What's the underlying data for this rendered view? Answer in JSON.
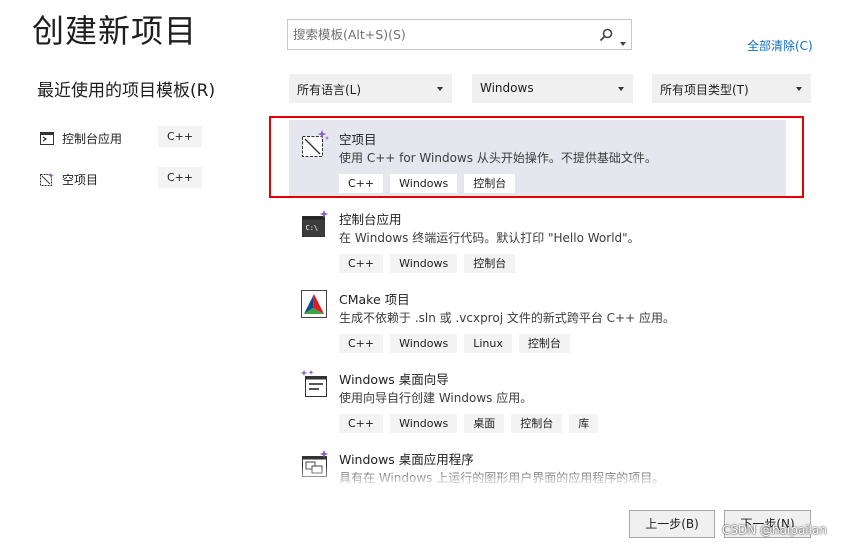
{
  "page": {
    "title": "创建新项目"
  },
  "search": {
    "placeholder": "搜索模板(Alt+S)(S)"
  },
  "clear_all": "全部清除(C)",
  "recent": {
    "title": "最近使用的项目模板(R)",
    "items": [
      {
        "label": "控制台应用",
        "tag": "C++",
        "icon": "console-app-icon"
      },
      {
        "label": "空项目",
        "tag": "C++",
        "icon": "empty-project-icon"
      }
    ]
  },
  "filters": {
    "language": "所有语言(L)",
    "platform": "Windows",
    "project_type": "所有项目类型(T)"
  },
  "templates": [
    {
      "name": "空项目",
      "desc": "使用 C++ for Windows 从头开始操作。不提供基础文件。",
      "tags": [
        "C++",
        "Windows",
        "控制台"
      ],
      "icon": "empty-project-icon",
      "selected": true
    },
    {
      "name": "控制台应用",
      "desc": "在 Windows 终端运行代码。默认打印 \"Hello World\"。",
      "tags": [
        "C++",
        "Windows",
        "控制台"
      ],
      "icon": "console-app-icon"
    },
    {
      "name": "CMake 项目",
      "desc": "生成不依赖于 .sln 或 .vcxproj 文件的新式跨平台 C++ 应用。",
      "tags": [
        "C++",
        "Windows",
        "Linux",
        "控制台"
      ],
      "icon": "cmake-icon"
    },
    {
      "name": "Windows 桌面向导",
      "desc": "使用向导自行创建 Windows 应用。",
      "tags": [
        "C++",
        "Windows",
        "桌面",
        "控制台",
        "库"
      ],
      "icon": "desktop-wizard-icon"
    },
    {
      "name": "Windows 桌面应用程序",
      "desc": "具有在 Windows 上运行的图形用户界面的应用程序的项目。",
      "tags": [],
      "icon": "desktop-app-icon"
    }
  ],
  "buttons": {
    "back": "上一步(B)",
    "next": "下一步(N)"
  },
  "watermark": "CSDN @haipailan",
  "colors": {
    "accent": "#0e70c0",
    "selection": "#e6e7ee",
    "highlight_border": "#e60000",
    "sparkle": "#8a5fc4"
  }
}
